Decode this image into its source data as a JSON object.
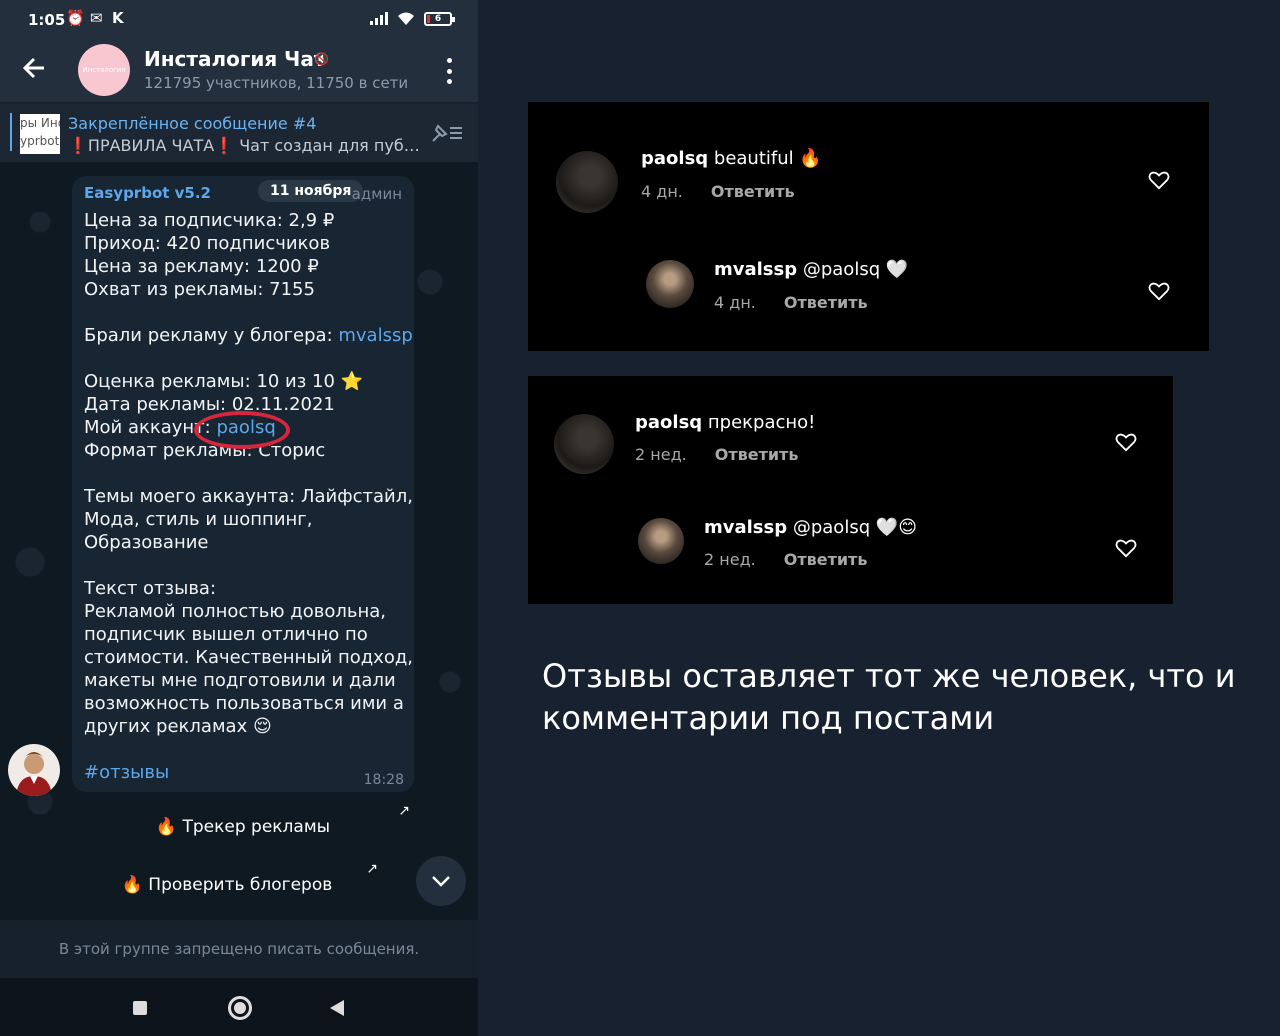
{
  "status": {
    "time": "1:05",
    "k_label": "K",
    "battery": "6"
  },
  "chat": {
    "avatar_text": "Инсталогия",
    "title": "Инсталогия Чат",
    "subtitle": "121795 участников, 11750 в сети"
  },
  "pinned": {
    "thumb_line1": "ры Инс",
    "thumb_line2": "yprbot",
    "title": "Закреплённое сообщение #4",
    "text": "❗ПРАВИЛА ЧАТА❗ Чат создан для публ…"
  },
  "message": {
    "sender": "Easyprbot v5.2",
    "date_chip": "11 ноября",
    "role": "админ",
    "lines": [
      {
        "text": "Цена за подписчика: 2,9 ₽"
      },
      {
        "text": "Приход: 420 подписчиков"
      },
      {
        "text": "Цена за рекламу: 1200 ₽"
      },
      {
        "text": "Охват из рекламы: 7155"
      },
      {
        "text": ""
      },
      {
        "text": "Брали рекламу у блогера: ",
        "link": "mvalssp"
      },
      {
        "text": ""
      },
      {
        "text": "Оценка рекламы: 10 из 10 ⭐"
      },
      {
        "text": "Дата рекламы: 02.11.2021"
      },
      {
        "text": "Мой аккаунт: ",
        "link": "paolsq"
      },
      {
        "text": "Формат рекламы: Сторис"
      },
      {
        "text": ""
      },
      {
        "text": "Темы моего аккаунта: Лайфстайл,"
      },
      {
        "text": "Мода, стиль и шоппинг,"
      },
      {
        "text": "Образование"
      },
      {
        "text": ""
      },
      {
        "text": "Текст отзыва:"
      },
      {
        "text": "Рекламой полностью довольна,"
      },
      {
        "text": "подписчик вышел отлично по"
      },
      {
        "text": "стоимости. Качественный подход,"
      },
      {
        "text": "макеты мне подготовили и дали"
      },
      {
        "text": "возможность пользоваться ими а"
      },
      {
        "text": "других рекламах 😌"
      },
      {
        "text": ""
      },
      {
        "text": "",
        "link": "#отзывы"
      }
    ],
    "time": "18:28"
  },
  "keyboard": {
    "btn1": "🔥 Трекер рекламы",
    "btn2": "🔥 Проверить блогеров",
    "arrow": "↗"
  },
  "footer": {
    "disabled_text": "В этой группе запрещено писать сообщения."
  },
  "ig1": {
    "c1_user": "paolsq",
    "c1_text": " beautiful 🔥",
    "c1_time": "4 дн.",
    "c1_reply": "Ответить",
    "c2_user": "mvalssp",
    "c2_text": " @paolsq 🤍",
    "c2_time": "4 дн.",
    "c2_reply": "Ответить"
  },
  "ig2": {
    "c1_user": "paolsq",
    "c1_text": " прекрасно!",
    "c1_time": "2 нед.",
    "c1_reply": "Ответить",
    "c2_user": "mvalssp",
    "c2_text": " @paolsq 🤍😊",
    "c2_time": "2 нед.",
    "c2_reply": "Ответить"
  },
  "caption": "Отзывы оставляет тот же человек, что и комментарии под постами",
  "colors": {
    "link": "#5ea7ea",
    "highlight_circle": "#d7263d",
    "bubble": "#182533",
    "ig_bg": "#000000"
  }
}
